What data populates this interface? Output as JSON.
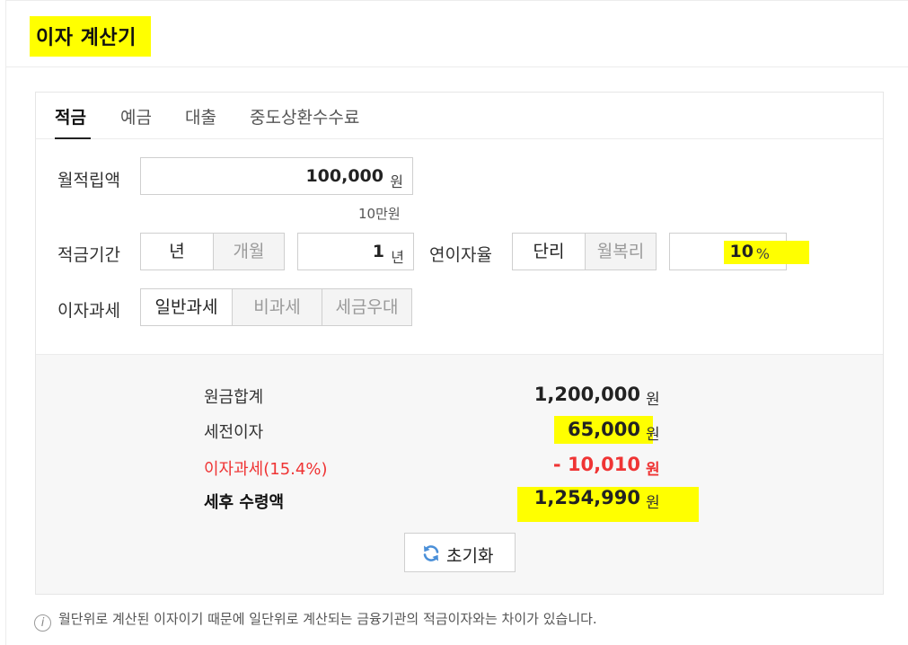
{
  "title": "이자 계산기",
  "tabs": [
    "적금",
    "예금",
    "대출",
    "중도상환수수료"
  ],
  "form": {
    "monthly_label": "월적립액",
    "monthly_value": "100,000",
    "monthly_unit": "원",
    "monthly_hint": "10만원",
    "period_label": "적금기간",
    "period_year": "년",
    "period_month": "개월",
    "period_value": "1",
    "period_unit": "년",
    "rate_label": "연이자율",
    "rate_simple": "단리",
    "rate_compound": "월복리",
    "rate_value": "10",
    "rate_unit": "%",
    "tax_label": "이자과세",
    "tax_general": "일반과세",
    "tax_none": "비과세",
    "tax_preferential": "세금우대"
  },
  "result": {
    "principal_label": "원금합계",
    "principal_value": "1,200,000",
    "interest_label": "세전이자",
    "interest_value": "65,000",
    "tax_label": "이자과세(15.4%)",
    "tax_value": "- 10,010",
    "net_label": "세후 수령액",
    "net_value": "1,254,990",
    "unit": "원"
  },
  "reset_label": "초기화",
  "note": "월단위로 계산된 이자이기 때문에 일단위로 계산되는 금융기관의 적금이자와는 차이가 있습니다.",
  "colors": {
    "highlight": "#ffff00",
    "tax_red": "#ef3434"
  },
  "icons": {
    "reset": "refresh-icon",
    "note": "info-icon"
  }
}
